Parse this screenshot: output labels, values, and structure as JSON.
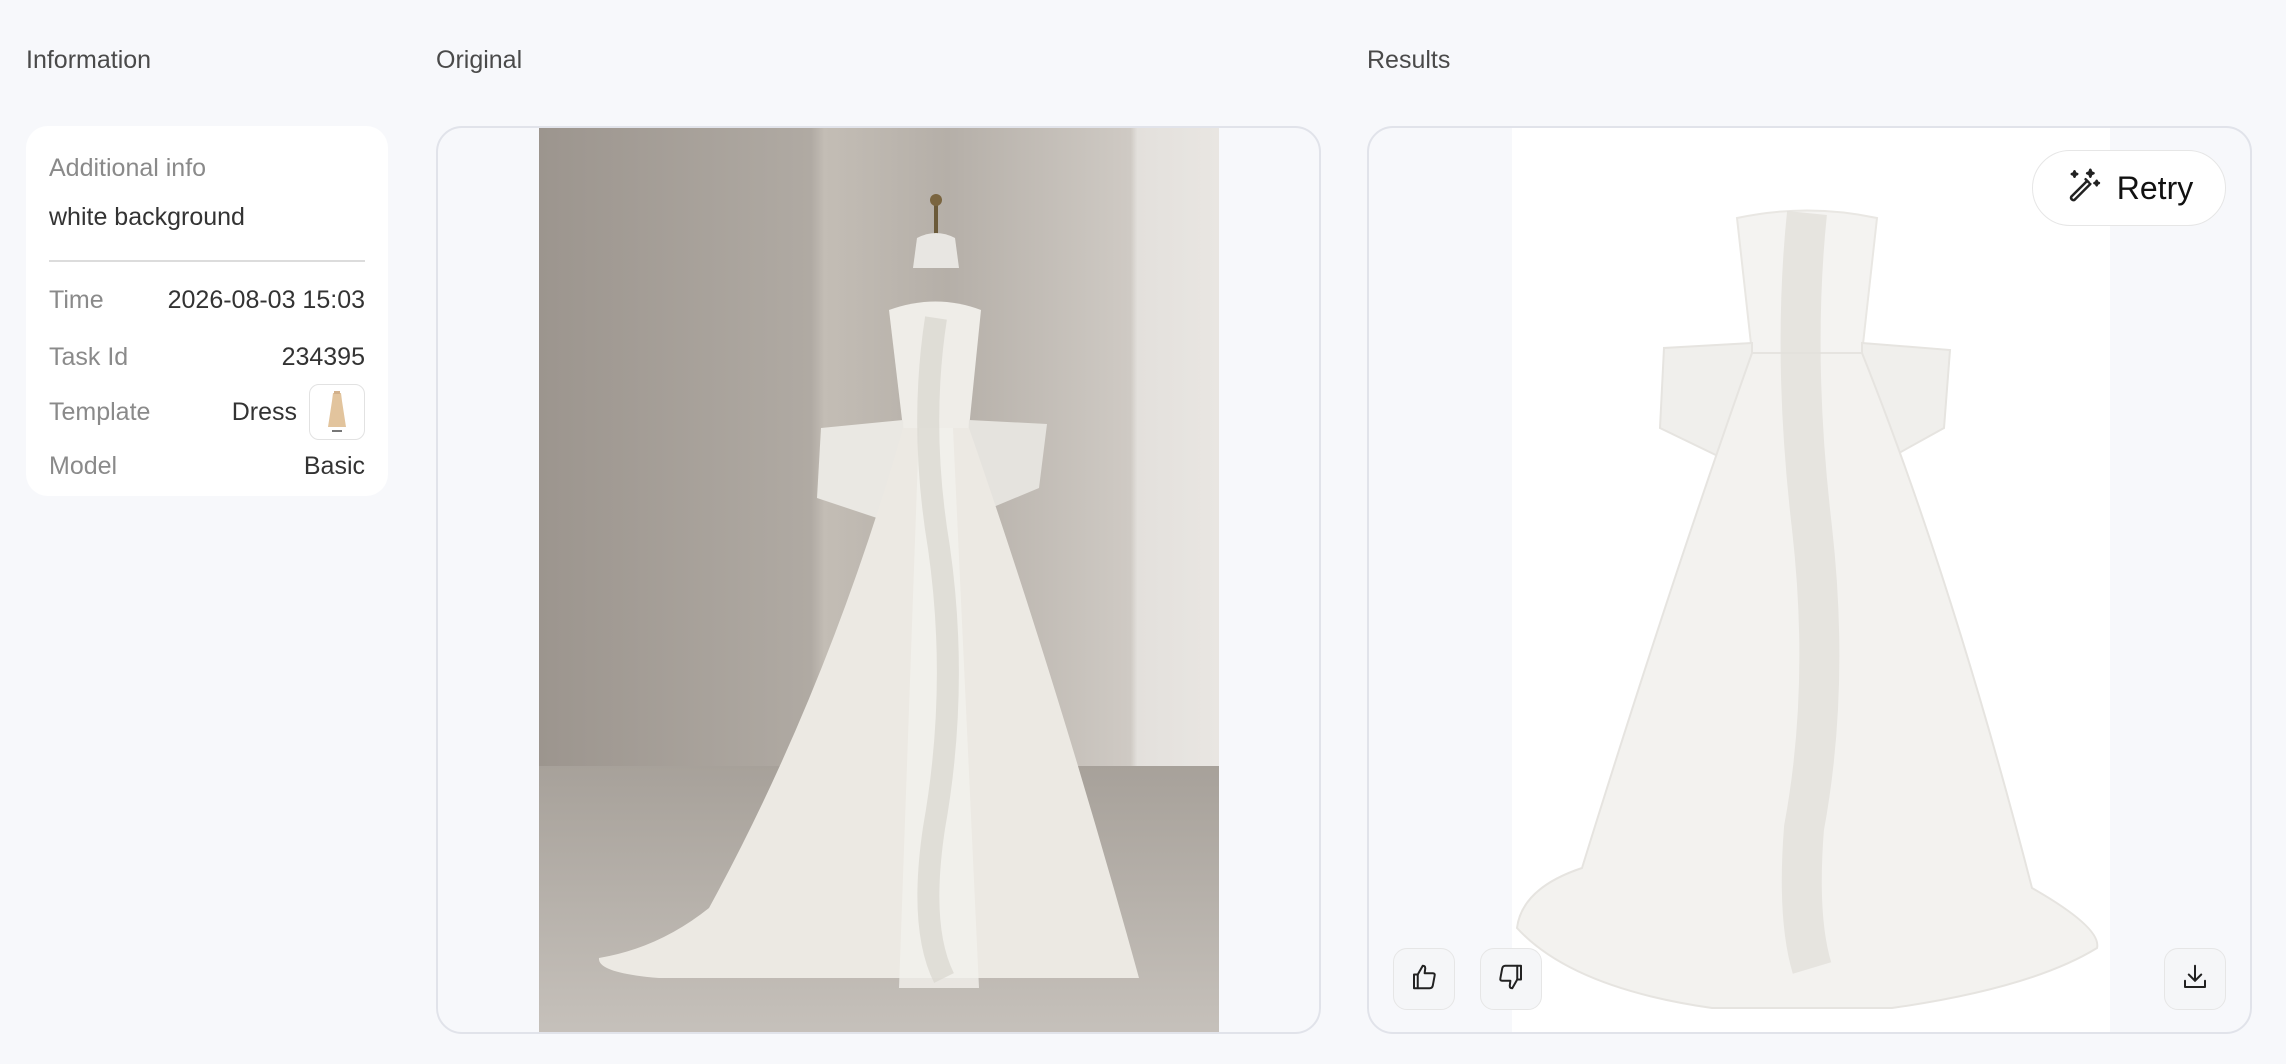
{
  "sections": {
    "information": "Information",
    "original": "Original",
    "results": "Results"
  },
  "info": {
    "additional_label": "Additional info",
    "additional_value": "white background",
    "rows": {
      "time": {
        "key": "Time",
        "value": "2026-08-03 15:03"
      },
      "task_id": {
        "key": "Task Id",
        "value": "234395"
      },
      "template": {
        "key": "Template",
        "value": "Dress"
      },
      "model": {
        "key": "Model",
        "value": "Basic"
      }
    }
  },
  "results": {
    "retry_label": "Retry"
  },
  "icons": {
    "retry": "magic-wand-icon",
    "like": "thumbs-up-icon",
    "dislike": "thumbs-down-icon",
    "download": "download-icon"
  },
  "colors": {
    "page_bg": "#f7f8fb",
    "card_bg": "#ffffff",
    "border": "#e1e3ea",
    "label_gray": "#8a8a8a",
    "text": "#333333"
  }
}
